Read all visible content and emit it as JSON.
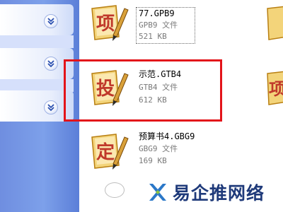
{
  "files": [
    {
      "glyph": "项",
      "name": "77.GPB9",
      "type": "GPB9 文件",
      "size": "521 KB"
    },
    {
      "glyph": "投",
      "name": "示范.GTB4",
      "type": "GTB4 文件",
      "size": "612 KB"
    },
    {
      "glyph": "定",
      "name": "预算书4.GBG9",
      "type": "GBG9 文件",
      "size": "169 KB"
    }
  ],
  "partial_right": [
    {
      "glyph": "项"
    }
  ],
  "watermark": {
    "text": "易企推网络"
  },
  "colors": {
    "selection": "#e3141a",
    "pane_blue": "#7da0ea",
    "icon_gold": "#e0a622",
    "glyph_red": "#c0392b"
  },
  "icons": [
    "chevron-down-icon",
    "file-icon",
    "pencil-icon",
    "logo-x-icon"
  ]
}
